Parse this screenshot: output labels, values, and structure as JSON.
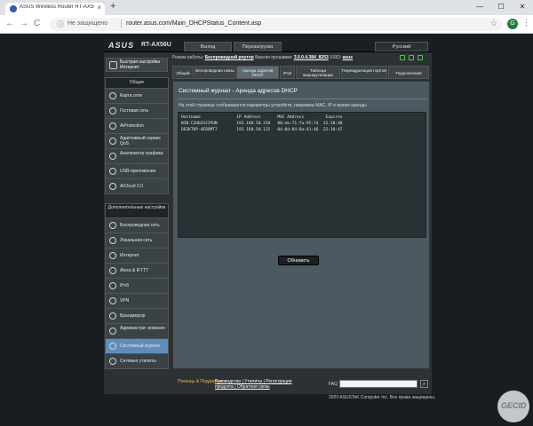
{
  "browser": {
    "tab_title": "ASUS Wireless Router RT-AX56...",
    "tab_close": "×",
    "new_tab": "+",
    "window_buttons": [
      "—",
      "☐",
      "✕"
    ],
    "back": "←",
    "forward": "→",
    "reload": "C",
    "security_label": "Не защищено",
    "url": "router.asus.com/Main_DHCPStatus_Content.asp",
    "star": "☆",
    "profile_initial": "G",
    "menu_glyph": "⋮"
  },
  "header": {
    "logo": "ASUS",
    "model": "RT-AX56U",
    "logout": "Выход",
    "reboot": "Перезагрузка",
    "language": "Русский"
  },
  "status": {
    "mode_label": "Режим работы:",
    "mode_value": "Беспроводной роутер",
    "fw_label": "Версия прошивки:",
    "fw_value": "3.0.0.4.384_8253",
    "ssid_label": "SSID:",
    "ssid_value": "asus"
  },
  "sidebar": {
    "qis": "Быстрая настройка Интернет",
    "general_title": "Общие",
    "general_items": [
      "Карта сети",
      "Гостевая сеть",
      "AiProtection",
      "Адаптивный сервис QoS",
      "Анализатор трафика",
      "USB-приложение",
      "AiCloud 2.0"
    ],
    "advanced_title": "Дополнительные настройки",
    "advanced_items": [
      "Беспроводная сеть",
      "Локальная сеть",
      "Интернет",
      "Alexa & IFTTT",
      "IPv6",
      "VPN",
      "Брандмауэр",
      "Администри- рование",
      "Системный журнал",
      "Сетевые утилиты"
    ]
  },
  "tabs": [
    "Общий",
    "Беспроводная связь",
    "Аренда адресов DHCP",
    "IPv6",
    "Таблица маршрутизации",
    "Переадресация портов",
    "Подключения"
  ],
  "content": {
    "title": "Системный журнал - Аренда адресов DHCP",
    "description": "На этой странице отображаются параметры устройств, например MAC, IP и время аренды",
    "log_lines": [
      "Hostname               IP Address       MAC Address         Expires",
      "WIN-C2HDZ4JIPUN        192.168.50.250   00:eb:71:fa:95:74  22:10:40",
      "DESKTOP-4EBOMT7        192.168.50.132   04:0d:04:0a:41:46  22:10:47"
    ],
    "refresh_button": "Обновить"
  },
  "footer": {
    "help": "Помощь & Поддержка",
    "links_line1": "Руководство | Утилиты | Регистрация",
    "links_line2": "продукта | Обратная связь",
    "faq_label": "FAQ",
    "faq_go": "⌕",
    "copyright": "2020 ASUSTeK Computer Inc. Все права защищены."
  },
  "watermark": "GECID"
}
